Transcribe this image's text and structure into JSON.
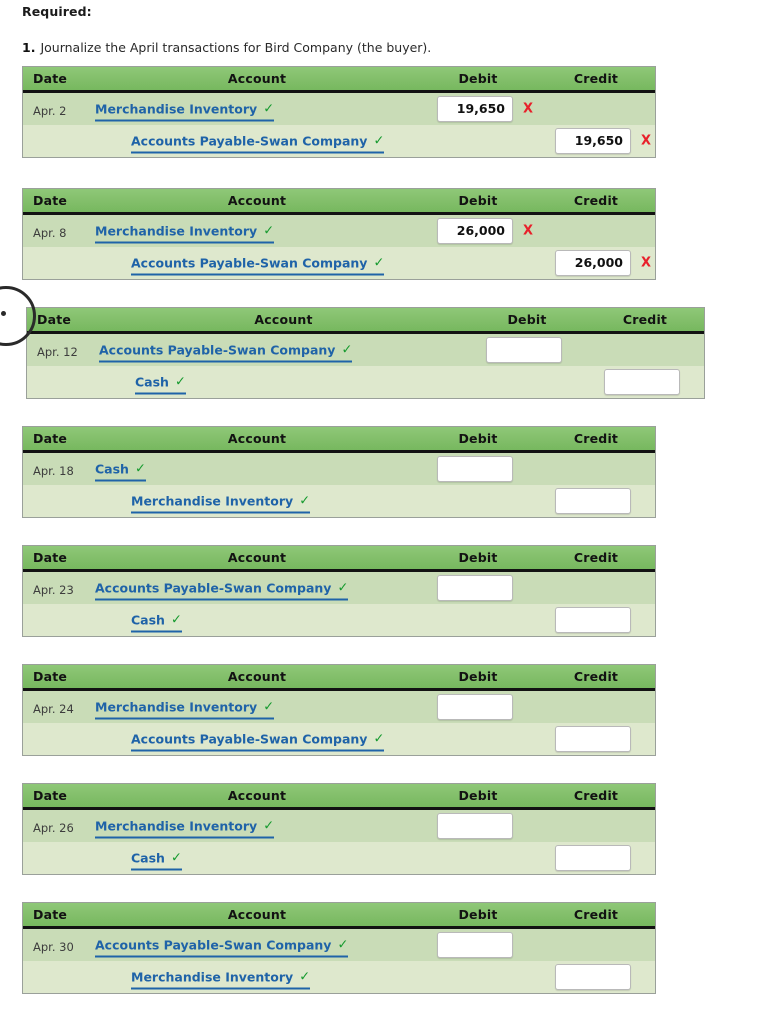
{
  "page": {
    "required_label": "Required:",
    "instruction_number": "1.",
    "instruction_text": "Journalize the April transactions for Bird Company (the buyer)."
  },
  "columns": {
    "date": "Date",
    "account": "Account",
    "debit": "Debit",
    "credit": "Credit"
  },
  "markers": {
    "check": "✓",
    "wrong": "X"
  },
  "colors": {
    "header_green": "#84c06c",
    "row_dark": "#c9dcb7",
    "row_light": "#dee8cd",
    "link_blue": "#1f63a8",
    "check_green": "#159a2e",
    "x_red": "#e8202a"
  },
  "journals": [
    {
      "id": "journal-apr-2",
      "date": "Apr. 2",
      "lines": [
        {
          "account": "Merchandise Inventory",
          "checked": true,
          "indent": 0,
          "debit": "19,650",
          "credit": "",
          "debit_wrong": true,
          "credit_wrong": false
        },
        {
          "account": "Accounts Payable-Swan Company",
          "checked": true,
          "indent": 1,
          "debit": "",
          "credit": "19,650",
          "debit_wrong": false,
          "credit_wrong": true
        }
      ]
    },
    {
      "id": "journal-apr-8",
      "date": "Apr. 8",
      "lines": [
        {
          "account": "Merchandise Inventory",
          "checked": true,
          "indent": 0,
          "debit": "26,000",
          "credit": "",
          "debit_wrong": true,
          "credit_wrong": false
        },
        {
          "account": "Accounts Payable-Swan Company",
          "checked": true,
          "indent": 1,
          "debit": "",
          "credit": "26,000",
          "debit_wrong": false,
          "credit_wrong": true
        }
      ]
    },
    {
      "id": "journal-apr-12",
      "date": "Apr. 12",
      "lines": [
        {
          "account": "Accounts Payable-Swan Company",
          "checked": true,
          "indent": 0,
          "debit": "",
          "credit": "",
          "debit_wrong": false,
          "credit_wrong": false
        },
        {
          "account": "Cash",
          "checked": true,
          "indent": 1,
          "debit": "",
          "credit": "",
          "debit_wrong": false,
          "credit_wrong": false
        }
      ]
    },
    {
      "id": "journal-apr-18",
      "date": "Apr. 18",
      "lines": [
        {
          "account": "Cash",
          "checked": true,
          "indent": 0,
          "debit": "",
          "credit": "",
          "debit_wrong": false,
          "credit_wrong": false
        },
        {
          "account": "Merchandise Inventory",
          "checked": true,
          "indent": 1,
          "debit": "",
          "credit": "",
          "debit_wrong": false,
          "credit_wrong": false
        }
      ]
    },
    {
      "id": "journal-apr-23",
      "date": "Apr. 23",
      "lines": [
        {
          "account": "Accounts Payable-Swan Company",
          "checked": true,
          "indent": 0,
          "debit": "",
          "credit": "",
          "debit_wrong": false,
          "credit_wrong": false
        },
        {
          "account": "Cash",
          "checked": true,
          "indent": 1,
          "debit": "",
          "credit": "",
          "debit_wrong": false,
          "credit_wrong": false
        }
      ]
    },
    {
      "id": "journal-apr-24",
      "date": "Apr. 24",
      "lines": [
        {
          "account": "Merchandise Inventory",
          "checked": true,
          "indent": 0,
          "debit": "",
          "credit": "",
          "debit_wrong": false,
          "credit_wrong": false
        },
        {
          "account": "Accounts Payable-Swan Company",
          "checked": true,
          "indent": 1,
          "debit": "",
          "credit": "",
          "debit_wrong": false,
          "credit_wrong": false
        }
      ]
    },
    {
      "id": "journal-apr-26",
      "date": "Apr. 26",
      "lines": [
        {
          "account": "Merchandise Inventory",
          "checked": true,
          "indent": 0,
          "debit": "",
          "credit": "",
          "debit_wrong": false,
          "credit_wrong": false
        },
        {
          "account": "Cash",
          "checked": true,
          "indent": 1,
          "debit": "",
          "credit": "",
          "debit_wrong": false,
          "credit_wrong": false
        }
      ]
    },
    {
      "id": "journal-apr-30",
      "date": "Apr. 30",
      "lines": [
        {
          "account": "Accounts Payable-Swan Company",
          "checked": true,
          "indent": 0,
          "debit": "",
          "credit": "",
          "debit_wrong": false,
          "credit_wrong": false
        },
        {
          "account": "Merchandise Inventory",
          "checked": true,
          "indent": 1,
          "debit": "",
          "credit": "",
          "debit_wrong": false,
          "credit_wrong": false
        }
      ]
    }
  ]
}
